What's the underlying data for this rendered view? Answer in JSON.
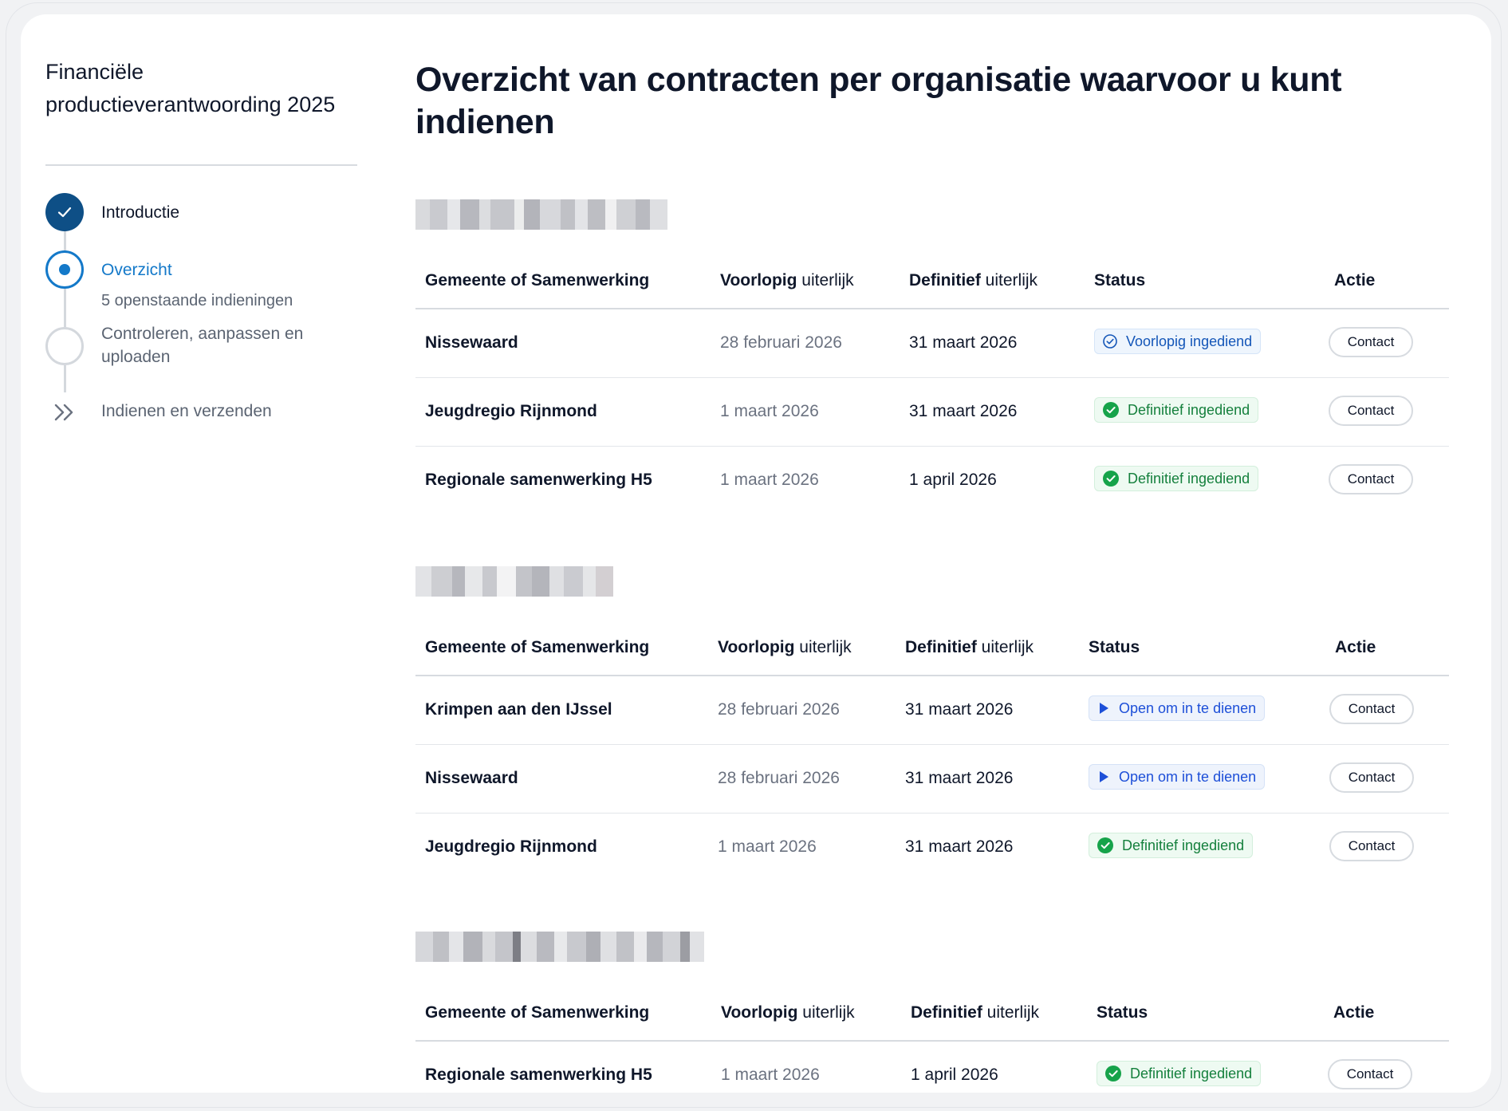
{
  "sidebar": {
    "title": "Financiële productieverantwoording 2025",
    "steps": [
      {
        "label": "Introductie",
        "state": "done"
      },
      {
        "label": "Overzicht",
        "state": "current",
        "sub": "5 openstaande indieningen"
      },
      {
        "label": "Controleren, aanpassen en uploaden",
        "state": "todo"
      },
      {
        "label": "Indienen en verzenden",
        "state": "todo"
      }
    ]
  },
  "main": {
    "title": "Overzicht van contracten per organisatie waarvoor u kunt indienen",
    "columns": {
      "name": "Gemeente of Samenwerking",
      "prov_bold": "Voorlopig",
      "prov_rest": " uiterlijk",
      "def_bold": "Definitief",
      "def_rest": " uiterlijk",
      "status": "Status",
      "action": "Actie"
    },
    "sections": [
      {
        "rows": [
          {
            "name": "Nissewaard",
            "provisional": "28 februari 2026",
            "final": "31 maart 2026",
            "status": "Voorlopig ingediend",
            "status_type": "provisional",
            "action": "Contact"
          },
          {
            "name": "Jeugdregio Rijnmond",
            "provisional": "1 maart 2026",
            "final": "31 maart 2026",
            "status": "Definitief ingediend",
            "status_type": "final",
            "action": "Contact"
          },
          {
            "name": "Regionale samenwerking H5",
            "provisional": "1 maart 2026",
            "final": "1 april 2026",
            "status": "Definitief ingediend",
            "status_type": "final",
            "action": "Contact"
          }
        ]
      },
      {
        "rows": [
          {
            "name": "Krimpen aan den IJssel",
            "provisional": "28 februari 2026",
            "final": "31 maart 2026",
            "status": "Open om in te dienen",
            "status_type": "open",
            "action": "Contact"
          },
          {
            "name": "Nissewaard",
            "provisional": "28 februari 2026",
            "final": "31 maart 2026",
            "status": "Open om in te dienen",
            "status_type": "open",
            "action": "Contact"
          },
          {
            "name": "Jeugdregio Rijnmond",
            "provisional": "1 maart 2026",
            "final": "31 maart 2026",
            "status": "Definitief ingediend",
            "status_type": "final",
            "action": "Contact"
          }
        ]
      },
      {
        "rows": [
          {
            "name": "Regionale samenwerking H5",
            "provisional": "1 maart 2026",
            "final": "1 april 2026",
            "status": "Definitief ingediend",
            "status_type": "final",
            "action": "Contact"
          }
        ]
      }
    ]
  },
  "colors": {
    "done_step": "#0e4f86",
    "current_step": "#1479c9",
    "status_provisional": "#1456b8",
    "status_final": "#15803d",
    "status_open": "#1d4fd8"
  },
  "icons": {
    "done_step": "check-icon",
    "todo_last_step": "double-chevron-right-icon",
    "status_provisional": "check-circle-outline-icon",
    "status_final": "check-circle-filled-icon",
    "status_open": "play-icon"
  }
}
